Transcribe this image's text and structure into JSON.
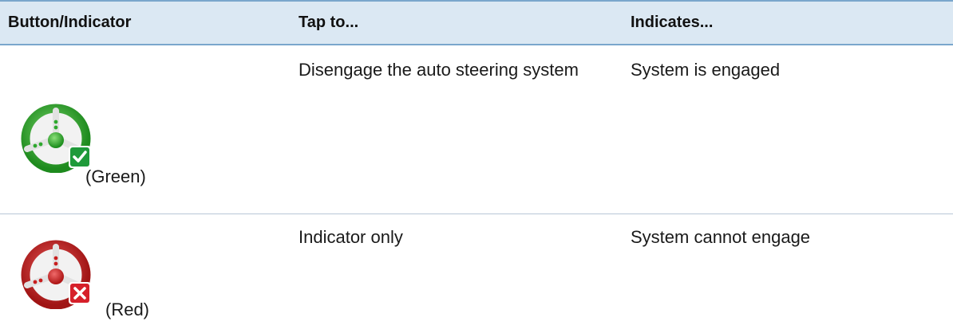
{
  "table": {
    "headers": {
      "button": "Button/Indicator",
      "tap": "Tap to...",
      "indicates": "Indicates..."
    },
    "rows": [
      {
        "icon": "steering-wheel-engaged-icon",
        "icon_color": "#2ea82e",
        "badge": "check",
        "badge_color": "#1f9a3a",
        "caption": "(Green)",
        "tap": "Disengage the auto steering system",
        "indicates": "System is engaged"
      },
      {
        "icon": "steering-wheel-cannot-engage-icon",
        "icon_color": "#c81e1e",
        "badge": "cross",
        "badge_color": "#d6202a",
        "caption": "(Red)",
        "tap": "Indicator only",
        "indicates": "System cannot engage"
      }
    ]
  },
  "colors": {
    "header_background": "#dbe8f3",
    "header_border": "#7aa6cc"
  }
}
